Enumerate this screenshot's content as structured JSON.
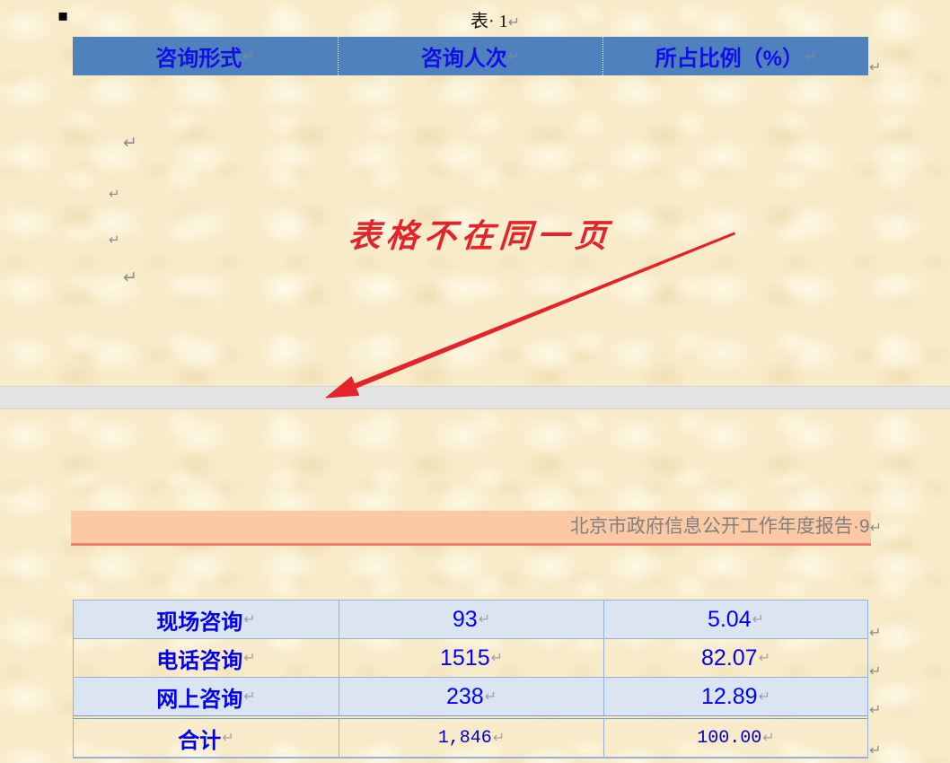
{
  "marks": {
    "paragraph": "↵",
    "bullet": "▪"
  },
  "page1": {
    "caption": "表· 1",
    "table": {
      "headers": [
        "咨询形式",
        "咨询人次",
        "所占比例（%）"
      ]
    }
  },
  "annotation": {
    "text": "表格不在同一页"
  },
  "page2": {
    "running_header": "北京市政府信息公开工作年度报告·9",
    "table": {
      "rows": [
        [
          "现场咨询",
          "93",
          "5.04"
        ],
        [
          "电话咨询",
          "1515",
          "82.07"
        ],
        [
          "网上咨询",
          "238",
          "12.89"
        ]
      ],
      "total": [
        "合计",
        "1,846",
        "100.00"
      ]
    }
  },
  "colors": {
    "header_bg": "#4f81bd",
    "header_text": "#1010e6",
    "band_bg": "#dbe5f1",
    "grid": "#95b3d7",
    "cell_text": "#0000ee",
    "annotation": "#e3242b",
    "page_gap": "#e3e3e3",
    "running_header_bg": "#fbc9a3",
    "running_header_border": "#f07f72",
    "running_header_text": "#808080",
    "format_mark": "#8c8c8c",
    "parchment": "#f8ebc9"
  }
}
